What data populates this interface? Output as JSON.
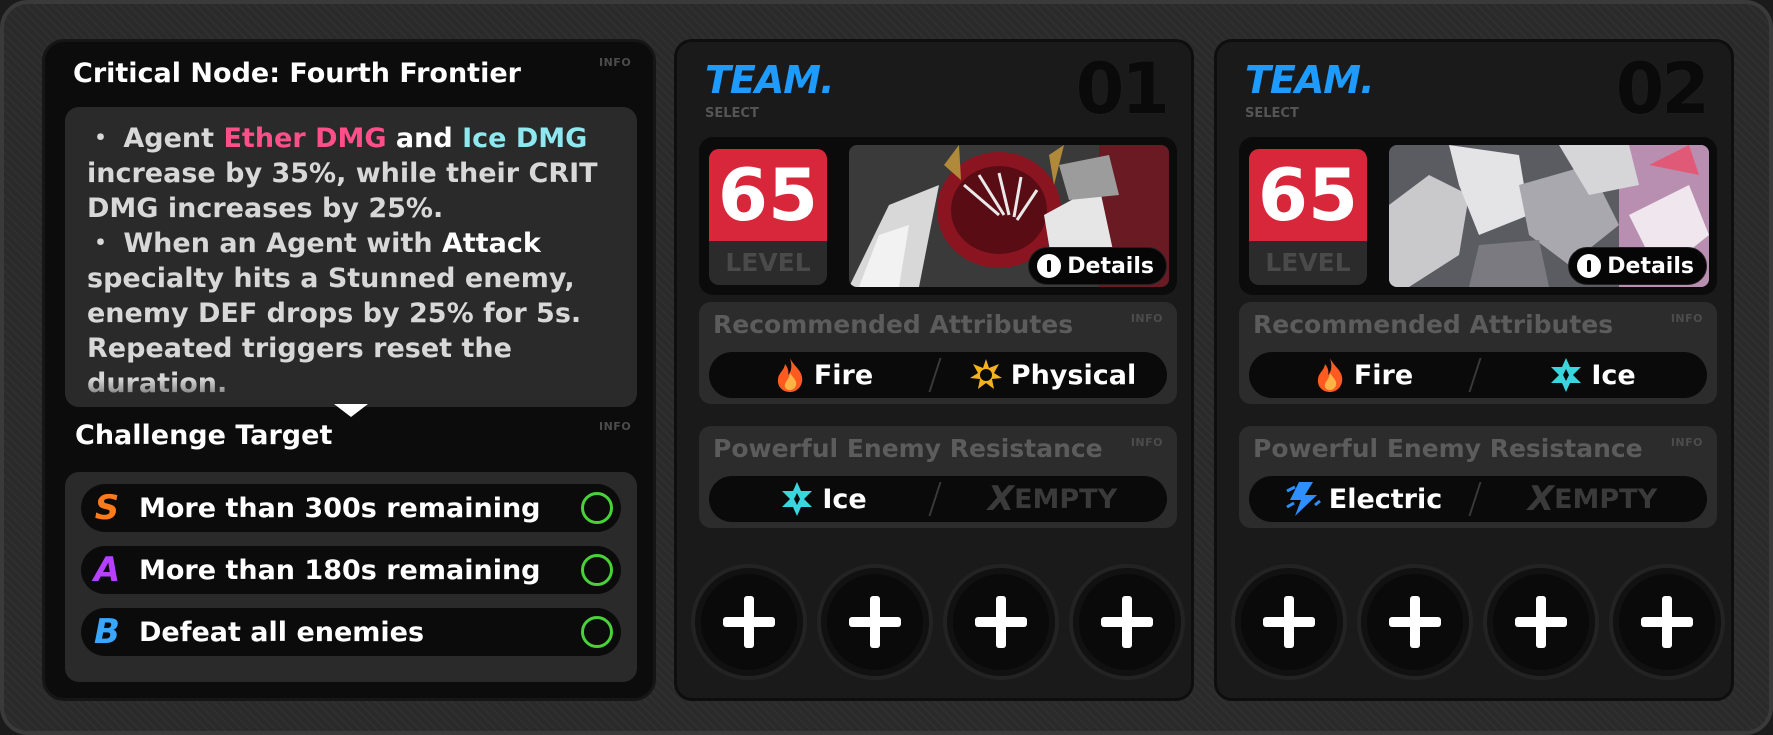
{
  "challenge": {
    "title": "Critical Node: Fourth Frontier",
    "info_label": "INFO",
    "effect_parts": [
      {
        "text": "・ Agent ",
        "style": "normal"
      },
      {
        "text": "Ether DMG",
        "style": "ether"
      },
      {
        "text": " and ",
        "style": "white"
      },
      {
        "text": "Ice DMG",
        "style": "ice"
      },
      {
        "text": " increase by 35%, while their CRIT DMG increases by 25%.",
        "style": "normal"
      },
      {
        "text": "・ When an Agent with ",
        "style": "normal"
      },
      {
        "text": "Attack",
        "style": "white"
      },
      {
        "text": " specialty hits a Stunned enemy, enemy DEF drops by 25% for 5s. Repeated triggers reset the duration.",
        "style": "normal"
      }
    ],
    "target_title": "Challenge Target",
    "targets": [
      {
        "grade": "S",
        "text": "More than 300s remaining"
      },
      {
        "grade": "A",
        "text": "More than 180s remaining"
      },
      {
        "grade": "B",
        "text": "Defeat all enemies"
      }
    ]
  },
  "teams": [
    {
      "label": "TEAM.",
      "select": "SELECT",
      "number": "01",
      "level": "65",
      "level_label": "LEVEL",
      "details": "Details",
      "recommended_title": "Recommended Attributes",
      "recommended": [
        {
          "name": "Fire",
          "icon": "fire-icon"
        },
        {
          "name": "Physical",
          "icon": "physical-icon"
        }
      ],
      "resistance_title": "Powerful Enemy Resistance",
      "resistance": [
        {
          "name": "Ice",
          "icon": "ice-icon"
        },
        {
          "name": "EMPTY",
          "icon": "x-icon"
        }
      ],
      "info_label": "INFO"
    },
    {
      "label": "TEAM.",
      "select": "SELECT",
      "number": "02",
      "level": "65",
      "level_label": "LEVEL",
      "details": "Details",
      "recommended_title": "Recommended Attributes",
      "recommended": [
        {
          "name": "Fire",
          "icon": "fire-icon"
        },
        {
          "name": "Ice",
          "icon": "ice-icon"
        }
      ],
      "resistance_title": "Powerful Enemy Resistance",
      "resistance": [
        {
          "name": "Electric",
          "icon": "electric-icon"
        },
        {
          "name": "EMPTY",
          "icon": "x-icon"
        }
      ],
      "info_label": "INFO"
    }
  ],
  "colors": {
    "ether": "#ff4f8a",
    "ice": "#8ee8f0",
    "team_blue": "#1e9bff",
    "level_red": "#d8263b",
    "grade_s": "#ff7a1a",
    "grade_a": "#b640ff",
    "grade_b": "#3aa7ff",
    "check_green": "#49d13a"
  }
}
